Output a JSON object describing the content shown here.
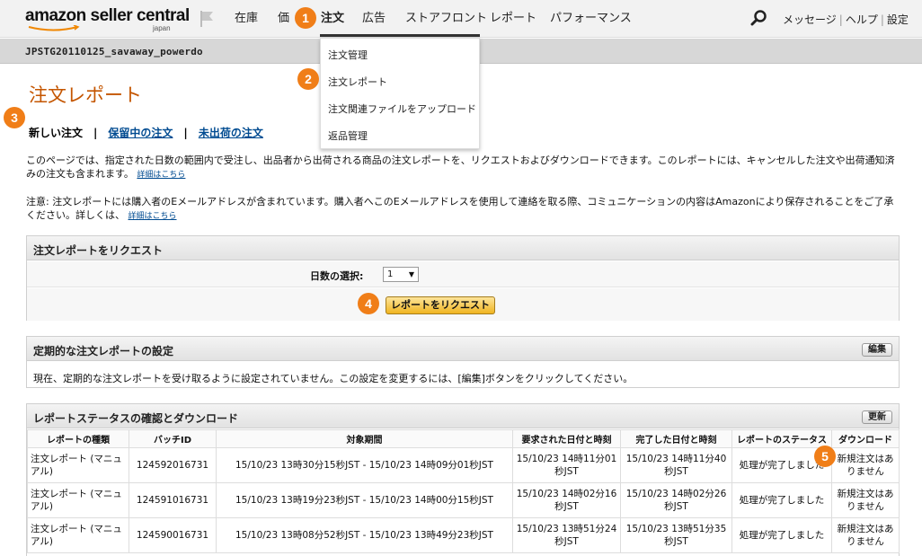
{
  "brand": {
    "logo_text": "amazon seller central",
    "logo_sub": "japan"
  },
  "nav": {
    "items": [
      "在庫",
      "価",
      "注文",
      "広告",
      "ストアフロント",
      "レポート",
      "パフォーマンス"
    ],
    "active": "注文",
    "top_links": [
      "メッセージ",
      "ヘルプ",
      "設定"
    ]
  },
  "account": {
    "name": "JPSTG20110125_savaway_powerdo"
  },
  "dropdown": {
    "items": [
      "注文管理",
      "注文レポート",
      "注文関連ファイルをアップロード",
      "返品管理"
    ]
  },
  "page": {
    "title": "注文レポート",
    "subtabs": [
      "新しい注文",
      "保留中の注文",
      "未出荷の注文"
    ],
    "description": "このページでは、指定された日数の範囲内で受注し、出品者から出荷される商品の注文レポートを、リクエストおよびダウンロードできます。このレポートには、キャンセルした注文や出荷通知済みの注文も含まれます。",
    "description_link": "詳細はこちら",
    "note": "注意:  注文レポートには購入者のEメールアドレスが含まれています。購入者へこのEメールアドレスを使用して連絡を取る際、コミュニケーションの内容はAmazonにより保存されることをご了承ください。詳しくは、",
    "note_link": "詳細はこちら"
  },
  "request_panel": {
    "title": "注文レポートをリクエスト",
    "days_label": "日数の選択:",
    "days_value": "1",
    "button_label": "レポートをリクエスト"
  },
  "schedule_panel": {
    "title": "定期的な注文レポートの設定",
    "edit_label": "編集",
    "message": "現在、定期的な注文レポートを受け取るように設定されていません。この設定を変更するには、[編集]ボタンをクリックしてください。"
  },
  "status_panel": {
    "title": "レポートステータスの確認とダウンロード",
    "refresh_label": "更新",
    "columns": [
      "レポートの種類",
      "バッチID",
      "対象期間",
      "要求された日付と時刻",
      "完了した日付と時刻",
      "レポートのステータス",
      "ダウンロード"
    ],
    "rows": [
      [
        "注文レポート (マニュアル)",
        "124592016731",
        "15/10/23 13時30分15秒JST - 15/10/23 14時09分01秒JST",
        "15/10/23 14時11分01秒JST",
        "15/10/23 14時11分40秒JST",
        "処理が完了しました",
        "新規注文はありません"
      ],
      [
        "注文レポート (マニュアル)",
        "124591016731",
        "15/10/23 13時19分23秒JST - 15/10/23 14時00分15秒JST",
        "15/10/23 14時02分16秒JST",
        "15/10/23 14時02分26秒JST",
        "処理が完了しました",
        "新規注文はありません"
      ],
      [
        "注文レポート (マニュアル)",
        "124590016731",
        "15/10/23 13時08分52秒JST - 15/10/23 13時49分23秒JST",
        "15/10/23 13時51分24秒JST",
        "15/10/23 13時51分35秒JST",
        "処理が完了しました",
        "新規注文はありません"
      ]
    ]
  },
  "callouts": [
    "1",
    "2",
    "3",
    "4",
    "5"
  ],
  "colors": {
    "accent": "#c45500",
    "link": "#004b91",
    "callout": "#f07e18",
    "button": "#f0b420"
  }
}
